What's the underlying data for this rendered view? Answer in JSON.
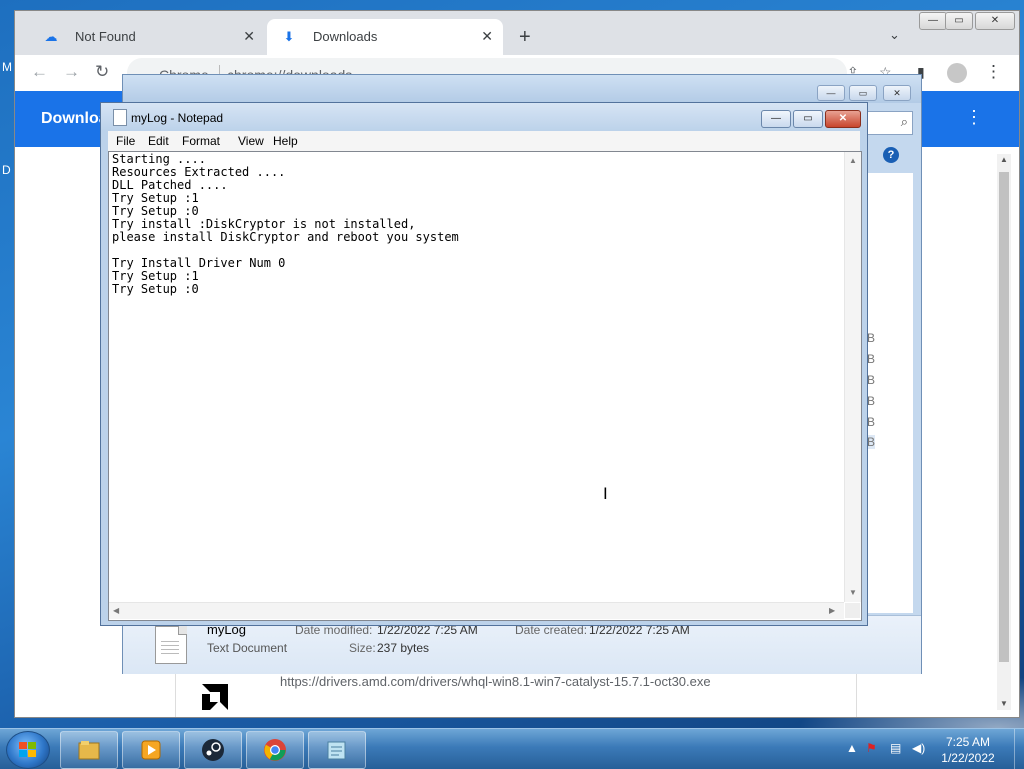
{
  "desktop": {
    "left_texts": [
      "M",
      "D"
    ]
  },
  "chrome": {
    "tabs": [
      {
        "label": "Not Found",
        "icon": "cloud-upload-icon"
      },
      {
        "label": "Downloads",
        "icon": "download-icon"
      }
    ],
    "tab_close": "✕",
    "new_tab": "+",
    "window_buttons": {
      "minimize": "—",
      "maximize": "▭",
      "close": "✕"
    },
    "omnibox": {
      "site": "Chrome",
      "url": "chrome://downloads"
    },
    "downloads_title": "Download",
    "menu_glyph": "⋮",
    "download_card": {
      "url": "https://drivers.amd.com/drivers/whql-win8.1-win7-catalyst-15.7.1-oct30.exe"
    }
  },
  "explorer": {
    "window_buttons": {
      "minimize": "—",
      "maximize": "▭",
      "close": "✕"
    },
    "help": "?",
    "size_fragments": [
      "B",
      "B",
      "B",
      "B",
      "B",
      "B"
    ],
    "details": {
      "file_name": "myLog",
      "file_type": "Text Document",
      "date_modified_label": "Date modified:",
      "date_modified": "1/22/2022 7:25 AM",
      "date_created_label": "Date created:",
      "date_created": "1/22/2022 7:25 AM",
      "size_label": "Size:",
      "size": "237 bytes"
    }
  },
  "notepad": {
    "title": "myLog - Notepad",
    "window_buttons": {
      "minimize": "—",
      "maximize": "▭",
      "close": "✕"
    },
    "menu": [
      "File",
      "Edit",
      "Format",
      "View",
      "Help"
    ],
    "content": "Starting ....\nResources Extracted ....\nDLL Patched ....\nTry Setup :1\nTry Setup :0\nTry install :DiskCryptor is not installed,\nplease install DiskCryptor and reboot you system\n\nTry Install Driver Num 0\nTry Setup :1\nTry Setup :0"
  },
  "taskbar": {
    "items": [
      "windows-explorer-icon",
      "media-player-icon",
      "steam-icon",
      "chrome-icon",
      "notepad-icon"
    ],
    "clock": {
      "time": "7:25 AM",
      "date": "1/22/2022"
    }
  }
}
